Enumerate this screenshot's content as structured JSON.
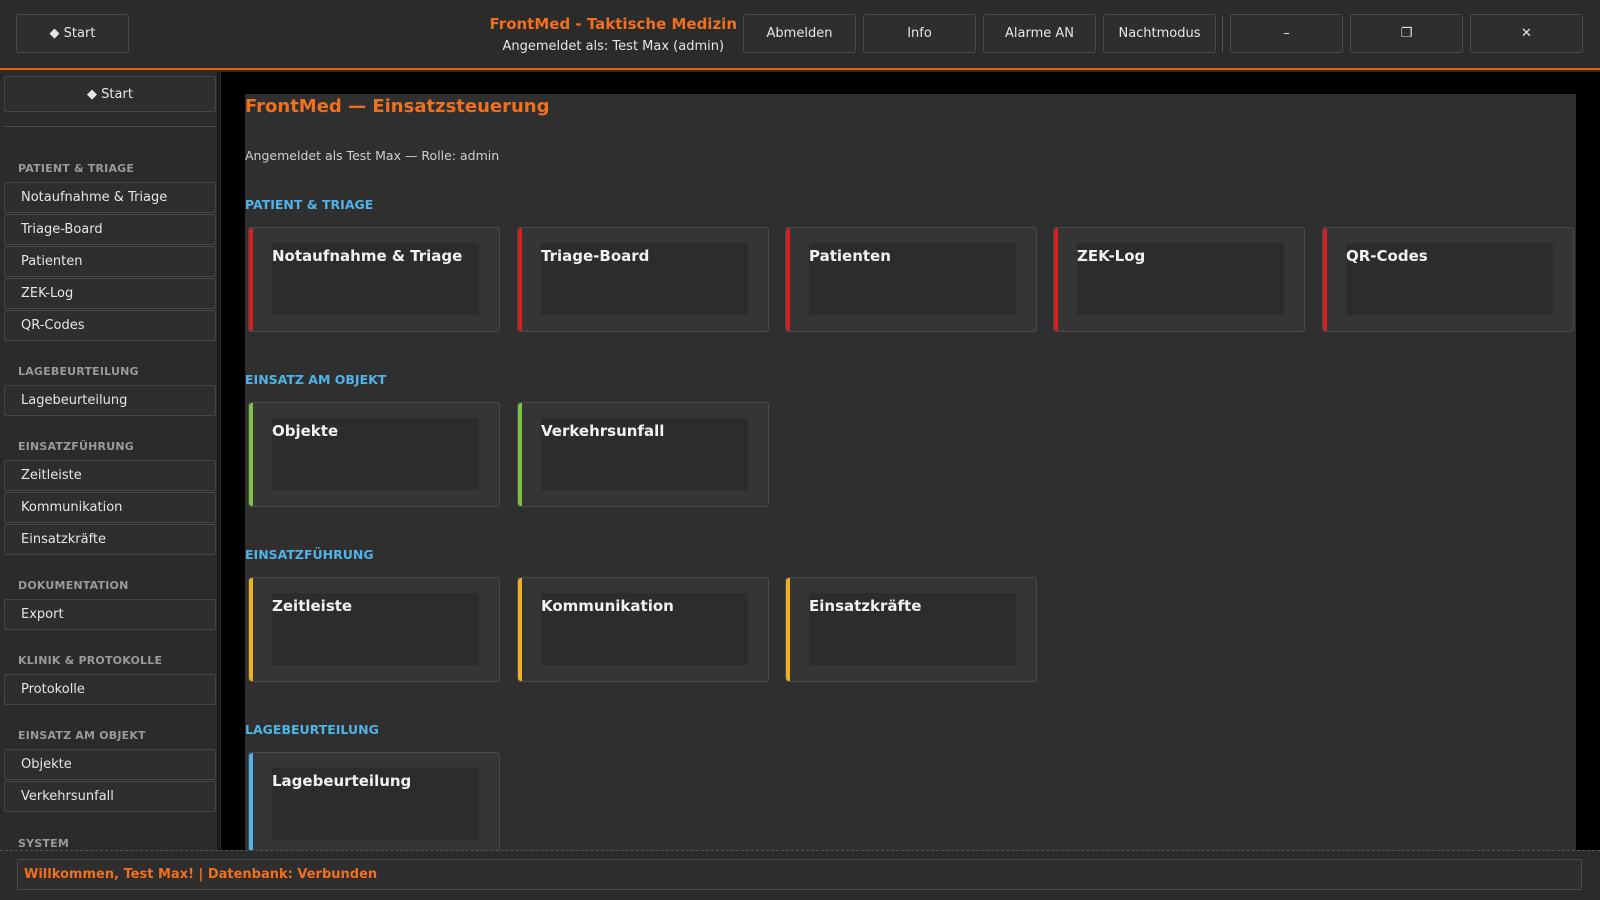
{
  "topbar": {
    "start_label": "◆ Start",
    "app_title": "FrontMed - Taktische Medizin",
    "logged_in": "Angemeldet als: Test Max (admin)",
    "buttons": [
      "Abmelden",
      "Info",
      "Alarme AN",
      "Nachtmodus"
    ],
    "window_controls": [
      "–",
      "❐",
      "✕"
    ]
  },
  "sidebar": {
    "start_label": "◆ Start",
    "sections": [
      {
        "title": "PATIENT & TRIAGE",
        "items": [
          "Notaufnahme & Triage",
          "Triage-Board",
          "Patienten",
          "ZEK-Log",
          "QR-Codes"
        ]
      },
      {
        "title": "LAGEBEURTEILUNG",
        "items": [
          "Lagebeurteilung"
        ]
      },
      {
        "title": "EINSATZFÜHRUNG",
        "items": [
          "Zeitleiste",
          "Kommunikation",
          "Einsatzkräfte"
        ]
      },
      {
        "title": "DOKUMENTATION",
        "items": [
          "Export"
        ]
      },
      {
        "title": "KLINIK & PROTOKOLLE",
        "items": [
          "Protokolle"
        ]
      },
      {
        "title": "EINSATZ AM OBJEKT",
        "items": [
          "Objekte",
          "Verkehrsunfall"
        ]
      },
      {
        "title": "SYSTEM",
        "items": []
      }
    ]
  },
  "main": {
    "title": "FrontMed — Einsatzsteuerung",
    "subtitle": "Angemeldet als Test Max — Rolle: admin",
    "sections": [
      {
        "title": "PATIENT & TRIAGE",
        "color": "#d42020",
        "cards": [
          "Notaufnahme & Triage",
          "Triage-Board",
          "Patienten",
          "ZEK-Log",
          "QR-Codes"
        ]
      },
      {
        "title": "EINSATZ AM OBJEKT",
        "color": "#7dc242",
        "cards": [
          "Objekte",
          "Verkehrsunfall"
        ]
      },
      {
        "title": "EINSATZFÜHRUNG",
        "color": "#f0b020",
        "cards": [
          "Zeitleiste",
          "Kommunikation",
          "Einsatzkräfte"
        ]
      },
      {
        "title": "LAGEBEURTEILUNG",
        "color": "#4fb3e8",
        "cards": [
          "Lagebeurteilung"
        ]
      }
    ]
  },
  "status": {
    "text": "Willkommen, Test Max! | Datenbank: Verbunden"
  },
  "colors": {
    "accent": "#f07020",
    "section_heading": "#4fb3e8"
  }
}
